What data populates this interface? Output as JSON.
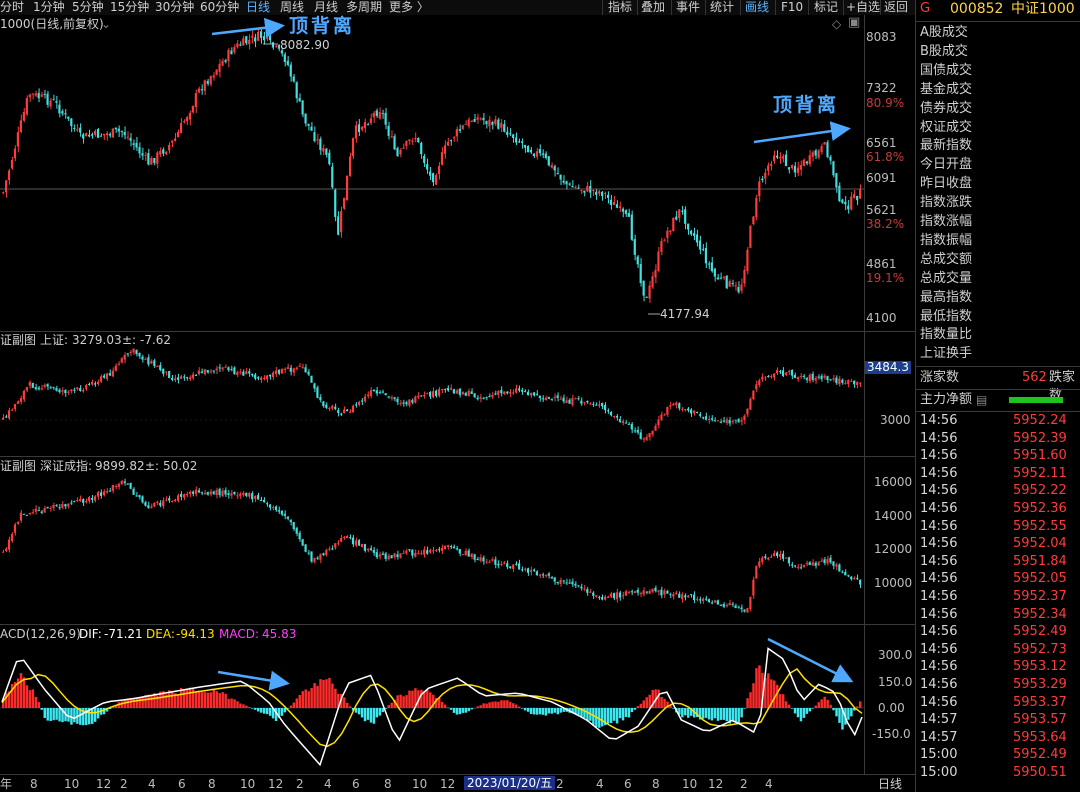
{
  "toolbar": {
    "tabs": [
      "分时",
      "1分钟",
      "5分钟",
      "15分钟",
      "30分钟",
      "60分钟",
      "日线",
      "周线",
      "月线",
      "多周期",
      "更多 〉"
    ],
    "active_tab": "日线",
    "right_items": [
      "指标",
      "叠加",
      "事件",
      "统计",
      "画线",
      "F10",
      "标记",
      "+自选",
      "返回"
    ],
    "active_right": "画线"
  },
  "main_chart": {
    "title": "1000(日线,前复权)",
    "high_label": "8082.90",
    "low_label": "4177.94",
    "y_ticks": [
      "8083",
      "7322",
      "6561",
      "6091",
      "5621",
      "4861",
      "4100"
    ],
    "pct_ticks": [
      "80.9%",
      "61.8%",
      "38.2%",
      "19.1%"
    ],
    "annotation_left": "顶背离",
    "annotation_right": "顶背离"
  },
  "sub1": {
    "name": "证副图",
    "index_label": "上证:",
    "index_value": "3279.03",
    "change_label": "±:",
    "change_value": "-7.62",
    "y_ticks": [
      "3484.3",
      "3000"
    ]
  },
  "sub2": {
    "name": "证副图",
    "index_label": "深证成指:",
    "index_value": "9899.82",
    "change_label": "±:",
    "change_value": "50.02",
    "y_ticks": [
      "16000",
      "14000",
      "12000",
      "10000"
    ]
  },
  "macd": {
    "title": "ACD(12,26,9)",
    "dif_label": "DIF:",
    "dif_value": "-71.21",
    "dea_label": "DEA:",
    "dea_value": "-94.13",
    "macd_label": "MACD:",
    "macd_value": "45.83",
    "y_ticks": [
      "300.0",
      "150.0",
      "0.00",
      "-150.0"
    ]
  },
  "x_axis": {
    "labels": [
      "年",
      "8",
      "10",
      "12",
      "2",
      "4",
      "6",
      "8",
      "10",
      "12",
      "2",
      "4",
      "6",
      "8",
      "10",
      "12",
      "2",
      "4",
      "6",
      "8",
      "10",
      "12",
      "2",
      "4"
    ],
    "cursor_date": "2023/01/20/五",
    "period": "日线"
  },
  "right_panel": {
    "flag": "G",
    "code": "000852",
    "name": "中证1000",
    "items": [
      "A股成交",
      "B股成交",
      "国债成交",
      "基金成交",
      "债券成交",
      "权证成交",
      "最新指数",
      "今日开盘",
      "昨日收盘",
      "指数涨跌",
      "指数涨幅",
      "指数振幅",
      "总成交额",
      "总成交量",
      "最高指数",
      "最低指数",
      "指数量比",
      "上证换手"
    ],
    "rise_label": "涨家数",
    "rise_value": "562",
    "fall_label": "跌家数",
    "main_flow_label": "主力净额",
    "ticks": [
      {
        "time": "14:56",
        "price": "5952.24"
      },
      {
        "time": "14:56",
        "price": "5952.39"
      },
      {
        "time": "14:56",
        "price": "5951.60"
      },
      {
        "time": "14:56",
        "price": "5952.11"
      },
      {
        "time": "14:56",
        "price": "5952.22"
      },
      {
        "time": "14:56",
        "price": "5952.36"
      },
      {
        "time": "14:56",
        "price": "5952.55"
      },
      {
        "time": "14:56",
        "price": "5952.04"
      },
      {
        "time": "14:56",
        "price": "5951.84"
      },
      {
        "time": "14:56",
        "price": "5952.05"
      },
      {
        "time": "14:56",
        "price": "5952.37"
      },
      {
        "time": "14:56",
        "price": "5952.34"
      },
      {
        "time": "14:56",
        "price": "5952.49"
      },
      {
        "time": "14:56",
        "price": "5952.73"
      },
      {
        "time": "14:56",
        "price": "5953.12"
      },
      {
        "time": "14:56",
        "price": "5953.29"
      },
      {
        "time": "14:56",
        "price": "5953.37"
      },
      {
        "time": "14:57",
        "price": "5953.57"
      },
      {
        "time": "14:57",
        "price": "5953.64"
      },
      {
        "time": "15:00",
        "price": "5952.49"
      },
      {
        "time": "15:00",
        "price": "5950.51"
      }
    ]
  },
  "colors": {
    "up": "#ff3b3b",
    "down": "#42e0e0",
    "dif": "#ffffff",
    "dea": "#ffe000",
    "macd_text": "#ff40ff",
    "accent": "#4fa8ff"
  }
}
